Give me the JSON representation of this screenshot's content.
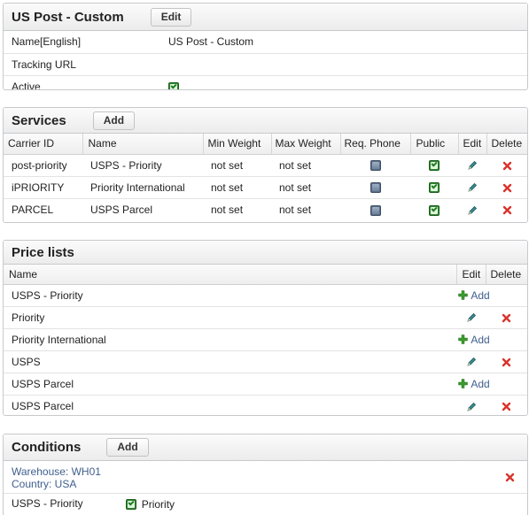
{
  "carrier": {
    "title": "US Post - Custom",
    "edit_label": "Edit",
    "fields": [
      {
        "label": "Name[English]",
        "value": "US Post - Custom"
      },
      {
        "label": "Tracking URL",
        "value": ""
      },
      {
        "label": "Active",
        "checked": true
      }
    ]
  },
  "services": {
    "title": "Services",
    "add_label": "Add",
    "columns": [
      "Carrier ID",
      "Name",
      "Min Weight",
      "Max Weight",
      "Req. Phone",
      "Public",
      "Edit",
      "Delete"
    ],
    "rows": [
      {
        "carrier_id": "post-priority",
        "name": "USPS - Priority",
        "min_weight": "not set",
        "max_weight": "not set",
        "req_phone": false,
        "public": true
      },
      {
        "carrier_id": "iPRIORITY",
        "name": "Priority International",
        "min_weight": "not set",
        "max_weight": "not set",
        "req_phone": false,
        "public": true
      },
      {
        "carrier_id": "PARCEL",
        "name": "USPS Parcel",
        "min_weight": "not set",
        "max_weight": "not set",
        "req_phone": false,
        "public": true
      }
    ]
  },
  "price_lists": {
    "title": "Price lists",
    "columns": [
      "Name",
      "Edit",
      "Delete"
    ],
    "add_text": "Add",
    "rows": [
      {
        "name": "USPS - Priority",
        "action": "add"
      },
      {
        "name": "Priority",
        "action": "edit"
      },
      {
        "name": "Priority International",
        "action": "add"
      },
      {
        "name": "USPS",
        "action": "edit"
      },
      {
        "name": "USPS Parcel",
        "action": "add"
      },
      {
        "name": "USPS Parcel",
        "action": "edit"
      }
    ]
  },
  "conditions": {
    "title": "Conditions",
    "add_label": "Add",
    "warehouse_line": "Warehouse: WH01",
    "country_line": "Country: USA",
    "service_name": "USPS - Priority",
    "service_option": "Priority",
    "service_option_checked": true
  },
  "colors": {
    "link": "#3f5f8f",
    "check_on": "#2f8a2f",
    "check_off": "#5b6e86",
    "delete_red": "#d9332b",
    "plus_green": "#3a9a2e"
  },
  "icons": {
    "edit": "pencil-icon",
    "delete": "delete-x-icon",
    "add": "plus-icon",
    "checkbox": "checkbox-icon"
  }
}
